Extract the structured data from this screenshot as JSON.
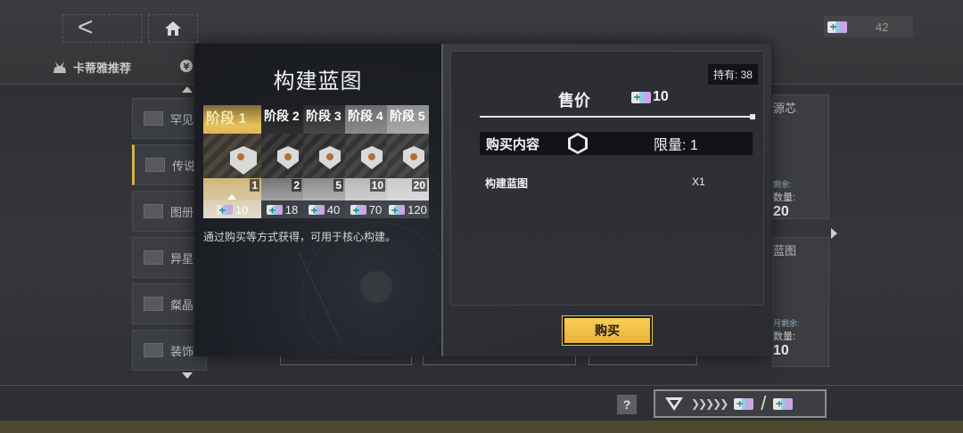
{
  "background": {
    "tabs": [
      {
        "label": "卡蒂雅推荐"
      }
    ],
    "currency": {
      "amount": "42"
    },
    "sidebar": [
      {
        "label": "罕见"
      },
      {
        "label": "传说"
      },
      {
        "label": "图册"
      },
      {
        "label": "异星"
      },
      {
        "label": "粲晶"
      },
      {
        "label": "装饰"
      }
    ],
    "right_cards": [
      {
        "label": "源芯",
        "remain": "剩余: ",
        "qty": "数量: ",
        "price": "20"
      },
      {
        "label": "蓝图",
        "remain": "月剩余: ",
        "qty": "数量: ",
        "price": "10"
      }
    ],
    "help_label": "?"
  },
  "modal": {
    "title": "构建蓝图",
    "stages": [
      {
        "label": "阶段 1",
        "count": "1",
        "cost": "10"
      },
      {
        "label": "阶段 2",
        "count": "2",
        "cost": "18"
      },
      {
        "label": "阶段 3",
        "count": "5",
        "cost": "40"
      },
      {
        "label": "阶段 4",
        "count": "10",
        "cost": "70"
      },
      {
        "label": "阶段 5",
        "count": "20",
        "cost": "120"
      }
    ],
    "description": "通过购买等方式获得，可用于核心构建。",
    "holding": "持有: 38",
    "price_label": "售价",
    "price_value": "10",
    "contents_header": "购买内容",
    "limit": "限量: 1",
    "item_name": "构建蓝图",
    "item_qty": "X1",
    "buy_label": "购买"
  },
  "colors": {
    "accent_gold": "#e9b33b",
    "panel_dark": "#1d1f26",
    "panel_grey": "#2e3035"
  }
}
